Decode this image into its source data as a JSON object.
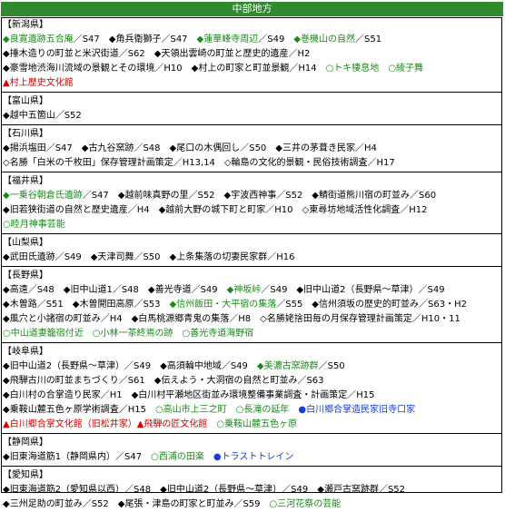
{
  "header": {
    "title": "中部地方"
  },
  "colors": {
    "header_bg": "#2e8b2e",
    "green": "#1a8a1a",
    "red": "#d00000",
    "blue": "#1a3fd0"
  },
  "sections": [
    {
      "name": "【新潟県】",
      "lines": [
        [
          {
            "t": "◆良寛遺跡五合庵",
            "c": "g"
          },
          {
            "t": "／S47　◆角兵衛獅子／S47　",
            "c": ""
          },
          {
            "t": "◆蓮華峰寺周辺",
            "c": "g"
          },
          {
            "t": "／S49　",
            "c": ""
          },
          {
            "t": "◆巻機山の自然",
            "c": "g"
          },
          {
            "t": "／S51",
            "c": ""
          }
        ],
        [
          {
            "t": "◆捶木造りの町並と米沢街道／S62　◆天領出雲崎の町並と歴史的遺産／H2",
            "c": ""
          }
        ],
        [
          {
            "t": "◆豪雪地渋海川流域の景観とその環境／H10　◆村上の町家と町並景観／H14　",
            "c": ""
          },
          {
            "t": "○トキ棲息地",
            "c": "g"
          },
          {
            "t": "　",
            "c": ""
          },
          {
            "t": "○綾子舞",
            "c": "g"
          }
        ],
        [
          {
            "t": "▲村上歴史文化館",
            "c": "r"
          }
        ]
      ]
    },
    {
      "name": "【富山県】",
      "lines": [
        [
          {
            "t": "◆越中五箇山／S52",
            "c": ""
          }
        ]
      ]
    },
    {
      "name": "【石川県】",
      "lines": [
        [
          {
            "t": "◆揚浜塩田／S47　◆古九谷窯跡／S48　◆尾口の木偶回し／S50　◆三井の茅葺き民家／H4",
            "c": ""
          }
        ],
        [
          {
            "t": "◇名勝「白米の千枚田」保存管理計画策定／H13,14　◇輪島の文化的景観・民俗技術調査／H17",
            "c": ""
          }
        ]
      ]
    },
    {
      "name": "【福井県】",
      "lines": [
        [
          {
            "t": "◆一乗谷朝倉氏遺跡",
            "c": "g"
          },
          {
            "t": "／S47　◆越前味真野の里／S52　◆宇波西神事／S52　◆鯖街道熊川宿の町並み／S60",
            "c": ""
          }
        ],
        [
          {
            "t": "◆旧若狭街道の自然と歴史遺産／H4　◆越前大野の城下町と町家／H10　◇東尋坊地域活性化調査／H12",
            "c": ""
          }
        ],
        [
          {
            "t": "○睦月神事芸能",
            "c": "g"
          }
        ]
      ]
    },
    {
      "name": "【山梨県】",
      "lines": [
        [
          {
            "t": "◆武田氏遺跡／S49　◆天津司舞／S50　◆上条集落の切妻民家群／H16",
            "c": ""
          }
        ]
      ]
    },
    {
      "name": "【長野県】",
      "lines": [
        [
          {
            "t": "◆高遠／S48　◆旧中山道1／S48　◆善光寺道／S49　",
            "c": ""
          },
          {
            "t": "◆神坂峠",
            "c": "g"
          },
          {
            "t": "／S49　◆旧中山道2（長野県～草津）／S49",
            "c": ""
          }
        ],
        [
          {
            "t": "◆木曽路／S51　◆木曽開田高原／S53　",
            "c": ""
          },
          {
            "t": "◆信州飯田・大平宿の集落",
            "c": "g"
          },
          {
            "t": "／S55　◆信州須坂の歴史的町並み／S63・H2",
            "c": ""
          }
        ],
        [
          {
            "t": "◆風穴と小諸宿の町並み／H4　◆白馬桃源郷青鬼の集落／H8　◇名勝姥捨田毎の月保存管理計画策定／H10・11",
            "c": ""
          }
        ],
        [
          {
            "t": "○中山道妻籠宿付近",
            "c": "g"
          },
          {
            "t": "　",
            "c": ""
          },
          {
            "t": "○小林一茶終焉の跡",
            "c": "g"
          },
          {
            "t": "　",
            "c": ""
          },
          {
            "t": "○善光寺道海野宿",
            "c": "g"
          }
        ]
      ]
    },
    {
      "name": "【岐阜県】",
      "lines": [
        [
          {
            "t": "◆旧中山道2（長野県～草津）／S49　◆高須輪中地域／S49　",
            "c": ""
          },
          {
            "t": "◆美濃古窯跡群",
            "c": "g"
          },
          {
            "t": "／S50",
            "c": ""
          }
        ],
        [
          {
            "t": "◆飛騨古川の町並まちづくり／S61　◆伝えよう・大洞宿の自然と町並み／S63",
            "c": ""
          }
        ],
        [
          {
            "t": "◆白川村の合掌造り民家／H1　◆白川村平瀬地区街並み環境整備事業調査・計画策定／H15",
            "c": ""
          }
        ],
        [
          {
            "t": "◆乗鞍山麓五色ヶ原学術調査／H15　",
            "c": ""
          },
          {
            "t": "○高山市上三之町",
            "c": "g"
          },
          {
            "t": "　",
            "c": ""
          },
          {
            "t": "○長滝の延年",
            "c": "g"
          },
          {
            "t": "　",
            "c": ""
          },
          {
            "t": "●白川郷合掌造民家旧寺口家",
            "c": "b"
          }
        ],
        [
          {
            "t": "▲白川郷合掌文化館（旧松井家）",
            "c": "r"
          },
          {
            "t": "▲飛騨の匠文化館",
            "c": "r"
          },
          {
            "t": "　",
            "c": ""
          },
          {
            "t": "○乗鞍山麓五色ヶ原",
            "c": "g"
          }
        ]
      ]
    },
    {
      "name": "【静岡県】",
      "lines": [
        [
          {
            "t": "◆旧東海道筋1（静岡県内）／S47　",
            "c": ""
          },
          {
            "t": "○西浦の田楽",
            "c": "g"
          },
          {
            "t": "　",
            "c": ""
          },
          {
            "t": "●トラストトレイン",
            "c": "b"
          }
        ]
      ]
    },
    {
      "name": "【愛知県】",
      "lines": [
        [
          {
            "t": "◆旧東海道筋2（愛知県以西）／S48　◆旧中山道2（長野県～草津）／S49　◆瀬戸古窯跡群／S52",
            "c": ""
          }
        ],
        [
          {
            "t": "◆三州足助の町並み／S52　◆尾張・津島の町家と町並み／S59　",
            "c": ""
          },
          {
            "t": "○三河花祭の芸能",
            "c": "g"
          }
        ]
      ]
    }
  ]
}
